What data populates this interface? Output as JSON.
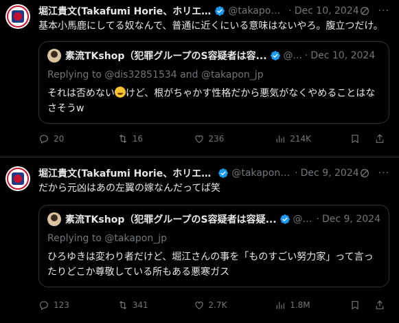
{
  "tweets": [
    {
      "author_name": "堀江貴文(Takafumi Horie、ホリエ...",
      "handle": "@takapon...",
      "date": "Dec 10, 2024",
      "text": "基本小馬鹿にしてる奴なんで、普通に近くにいる意味はないやろ。腹立つだけ。",
      "quote": {
        "author_name": "素流TKshop（犯罪グループのS容疑者は容...",
        "handle": "@...",
        "date": "Dec 10, 2024",
        "replying_prefix": "Replying to ",
        "replying_user1": "@dis32851534",
        "replying_and": " and ",
        "replying_user2": "@takapon_jp",
        "text_before_emoji": "それは否めない",
        "emoji": "rolling-on-floor-laughing-emoji",
        "text_after_emoji": "けど、根がちゃかす性格だから悪気がなくやめることはなさそうw"
      },
      "stats": {
        "replies": "20",
        "retweets": "16",
        "likes": "236",
        "views": "214K"
      }
    },
    {
      "author_name": "堀江貴文(Takafumi Horie、ホリエモ...",
      "handle": "@takapon_...",
      "date": "Dec 9, 2024",
      "text": "だから元凶はあの左翼の嫁なんだってば笑",
      "quote": {
        "author_name": "素流TKshop（犯罪グループのS容疑者は容疑...",
        "handle": "@T...",
        "date": "Dec 9, 2024",
        "replying_prefix": "Replying to ",
        "replying_user1": "@takapon_jp",
        "text": "ひろゆきは変わり者だけど、堀江さんの事を「ものすごい努力家」って言ったりどこか尊敬している所もある悪寒ガス"
      },
      "stats": {
        "replies": "123",
        "retweets": "341",
        "likes": "2.7K",
        "views": "1.8M"
      }
    }
  ],
  "separator": "·",
  "colors": {
    "background": "#000000",
    "text": "#e7e9ea",
    "muted": "#71767b",
    "verified": "#1d9bf0",
    "border": "#2f3336"
  }
}
